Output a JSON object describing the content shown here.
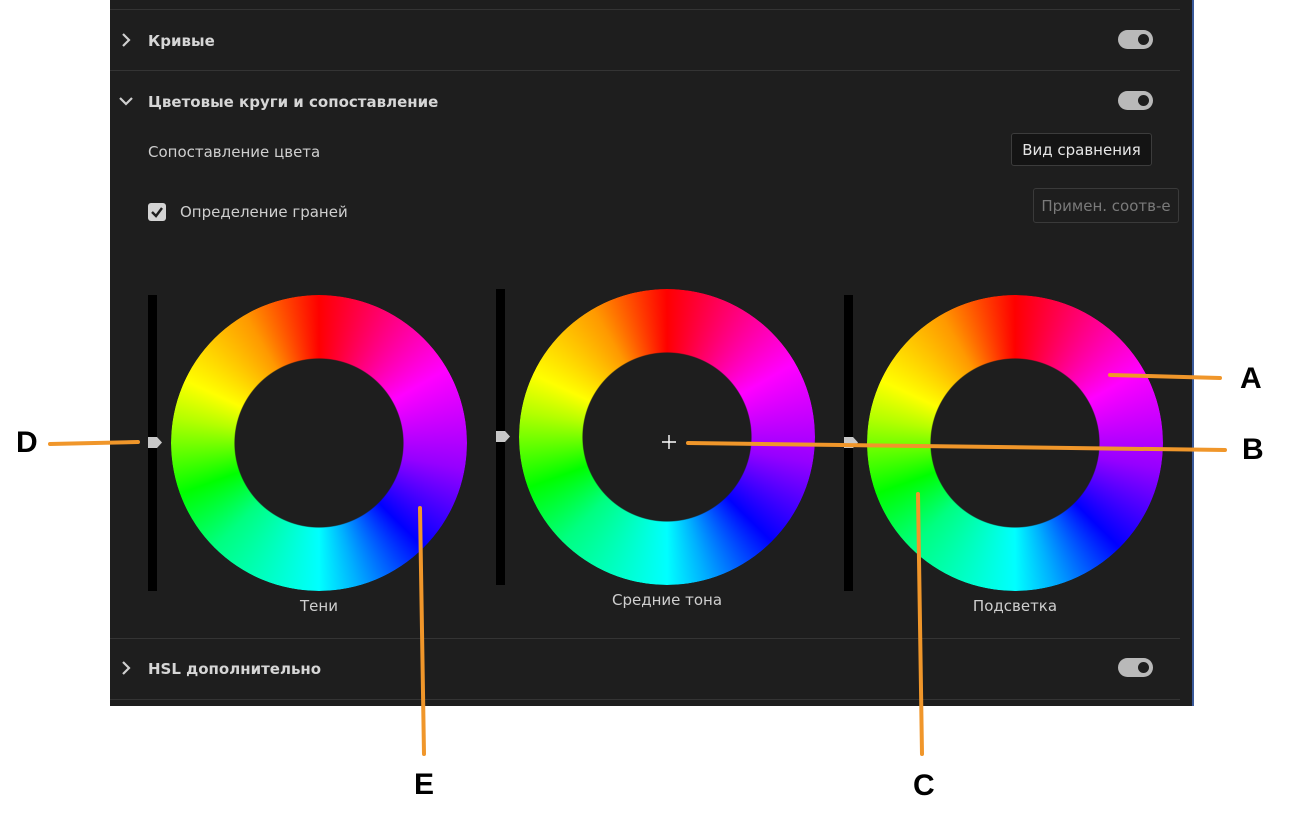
{
  "sections": {
    "curves": {
      "title": "Кривые",
      "enabled": true
    },
    "color_wheels": {
      "title": "Цветовые круги и сопоставление",
      "enabled": true
    },
    "hsl": {
      "title": "HSL дополнительно",
      "enabled": true
    }
  },
  "color_match": {
    "label": "Сопоставление цвета",
    "compare_button": "Вид сравнения",
    "face_detection_label": "Определение граней",
    "face_detection_checked": true,
    "apply_button": "Примен. соотв-е"
  },
  "wheels": [
    {
      "label": "Тени"
    },
    {
      "label": "Средние тона"
    },
    {
      "label": "Подсветка"
    }
  ],
  "callouts": {
    "A": "A",
    "B": "B",
    "C": "C",
    "D": "D",
    "E": "E",
    "line_color": "#f0962a"
  },
  "icons": {
    "chevron_collapsed": "chevron-right-icon",
    "chevron_expanded": "chevron-down-icon",
    "checkmark": "checkmark-icon",
    "crosshair": "crosshair-icon",
    "slider_thumb": "slider-thumb-icon"
  }
}
